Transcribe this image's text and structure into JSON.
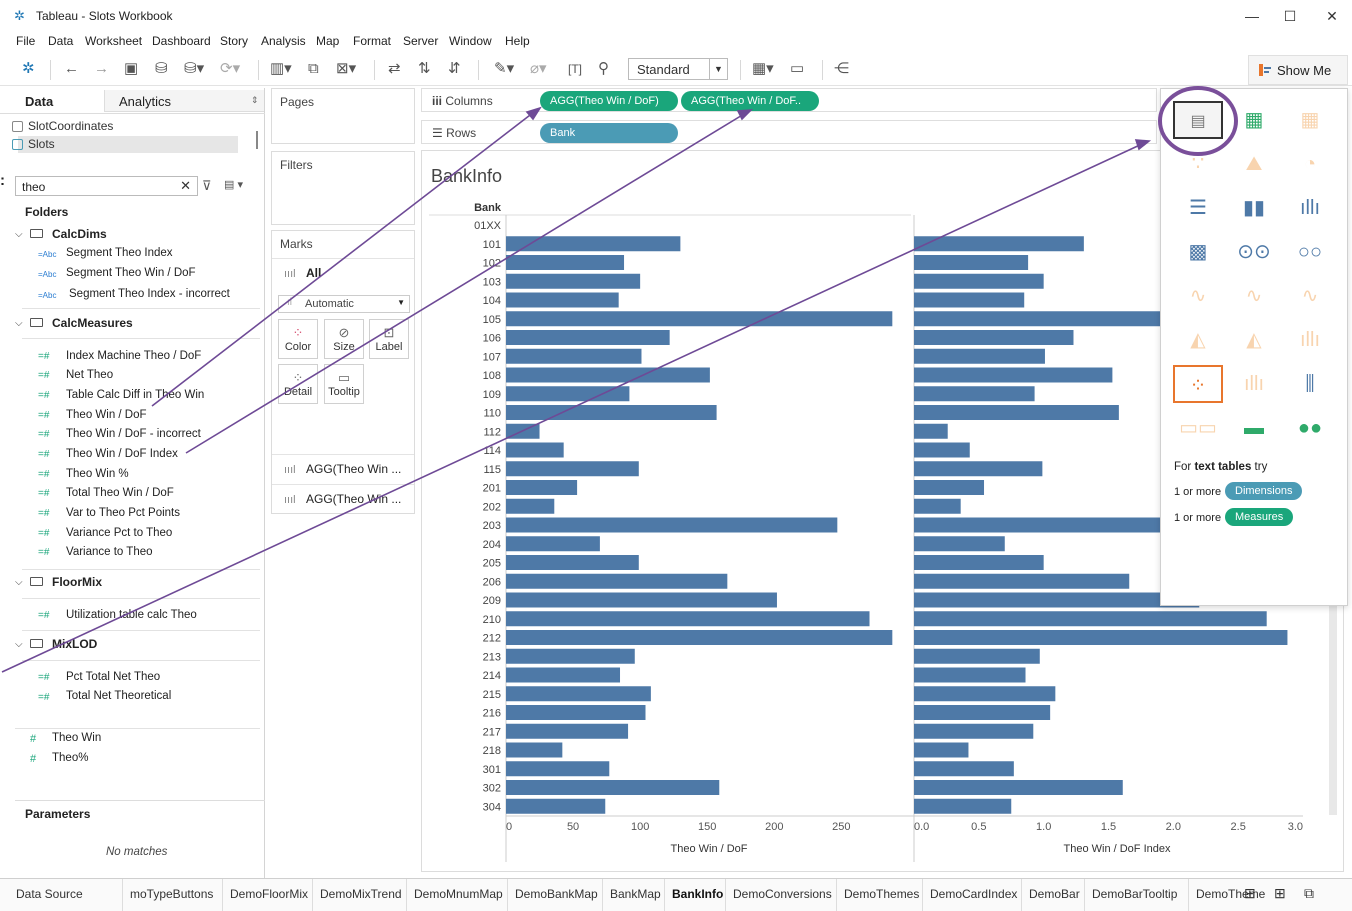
{
  "window": {
    "title": "Tableau - Slots Workbook",
    "minimize": "—",
    "maximize": "☐",
    "close": "✕"
  },
  "menu": [
    "File",
    "Data",
    "Worksheet",
    "Dashboard",
    "Story",
    "Analysis",
    "Map",
    "Format",
    "Server",
    "Window",
    "Help"
  ],
  "toolbar": {
    "fit_dropdown": "Standard",
    "show_me_label": "Show Me"
  },
  "data_pane": {
    "tab_data": "Data",
    "tab_analytics": "Analytics",
    "sources": [
      "SlotCoordinates",
      "Slots"
    ],
    "search_value": "theo",
    "folders_header": "Folders",
    "folders": [
      {
        "name": "CalcDims",
        "fields": [
          "Segment Theo Index",
          "Segment Theo Win / DoF",
          "Segment Theo Index - incorrect"
        ]
      },
      {
        "name": "CalcMeasures",
        "fields": [
          "Index Machine Theo / DoF",
          "Net Theo",
          "Table Calc Diff in Theo Win",
          "Theo Win / DoF",
          "Theo Win / DoF - incorrect",
          "Theo Win / DoF Index",
          "Theo Win %",
          "Total Theo Win / DoF",
          "Var to Theo Pct Points",
          "Variance Pct to Theo",
          "Variance to Theo"
        ]
      },
      {
        "name": "FloorMix",
        "fields": [
          "Utilization table calc Theo"
        ]
      },
      {
        "name": "MixLOD",
        "fields": [
          "Pct Total Net Theo",
          "Total Net Theoretical"
        ]
      }
    ],
    "loose_fields": [
      "Theo Win",
      "Theo%"
    ],
    "parameters_header": "Parameters",
    "parameters_empty": "No matches"
  },
  "cards": {
    "pages": "Pages",
    "filters": "Filters",
    "marks": "Marks",
    "marks_all": "All",
    "mark_type": "Automatic",
    "mark_buttons": [
      "Color",
      "Size",
      "Label",
      "Detail",
      "Tooltip"
    ],
    "mark_sub": [
      "AGG(Theo Win ...",
      "AGG(Theo Win ..."
    ]
  },
  "shelves": {
    "columns_label": "Columns",
    "rows_label": "Rows",
    "column_pills": [
      "AGG(Theo Win / DoF)",
      "AGG(Theo Win / DoF.."
    ],
    "row_pills": [
      "Bank"
    ]
  },
  "sheet_title": "BankInfo",
  "chart_data": [
    {
      "type": "bar",
      "orientation": "horizontal",
      "row_header": "Bank",
      "categories": [
        "01XX",
        "101",
        "102",
        "103",
        "104",
        "105",
        "106",
        "107",
        "108",
        "109",
        "110",
        "112",
        "114",
        "115",
        "201",
        "202",
        "203",
        "204",
        "205",
        "206",
        "209",
        "210",
        "212",
        "213",
        "214",
        "215",
        "216",
        "217",
        "218",
        "301",
        "302",
        "304"
      ],
      "values": [
        0,
        130,
        88,
        100,
        84,
        288,
        122,
        101,
        152,
        92,
        157,
        25,
        43,
        99,
        53,
        36,
        247,
        70,
        99,
        165,
        202,
        271,
        288,
        96,
        85,
        108,
        104,
        91,
        42,
        77,
        159,
        74
      ],
      "xlabel": "Theo Win / DoF",
      "xticks": [
        "0",
        "50",
        "100",
        "150",
        "200",
        "250"
      ],
      "xlim": [
        0,
        290
      ],
      "color": "#4e79a7"
    },
    {
      "type": "bar",
      "orientation": "horizontal",
      "categories": [
        "01XX",
        "101",
        "102",
        "103",
        "104",
        "105",
        "106",
        "107",
        "108",
        "109",
        "110",
        "112",
        "114",
        "115",
        "201",
        "202",
        "203",
        "204",
        "205",
        "206",
        "209",
        "210",
        "212",
        "213",
        "214",
        "215",
        "216",
        "217",
        "218",
        "301",
        "302",
        "304"
      ],
      "values": [
        0,
        1.31,
        0.88,
        1.0,
        0.85,
        2.2,
        1.23,
        1.01,
        1.53,
        0.93,
        1.58,
        0.26,
        0.43,
        0.99,
        0.54,
        0.36,
        2.2,
        0.7,
        1.0,
        1.66,
        2.2,
        2.72,
        2.88,
        0.97,
        0.86,
        1.09,
        1.05,
        0.92,
        0.42,
        0.77,
        1.61,
        0.75
      ],
      "xlabel": "Theo Win / DoF Index",
      "xticks": [
        "0.0",
        "0.5",
        "1.0",
        "1.5",
        "2.0",
        "2.5",
        "3.0"
      ],
      "xlim": [
        0,
        3.0
      ],
      "color": "#4e79a7"
    }
  ],
  "show_me": {
    "hint_prefix": "For ",
    "hint_bold": "text tables",
    "hint_suffix": " try",
    "dims_prefix": "1 or more",
    "dims_label": "Dimensions",
    "meas_prefix": "1 or more",
    "meas_label": "Measures",
    "accent": "#7a4f9a"
  },
  "tabs": [
    "Data Source",
    "moTypeButtons",
    "DemoFloorMix",
    "DemoMixTrend",
    "DemoMnumMap",
    "DemoBankMap",
    "BankMap",
    "BankInfo",
    "DemoConversions",
    "DemoThemes",
    "DemoCardIndex",
    "DemoBar",
    "DemoBarTooltip",
    "DemoTheme"
  ],
  "active_tab": "BankInfo"
}
